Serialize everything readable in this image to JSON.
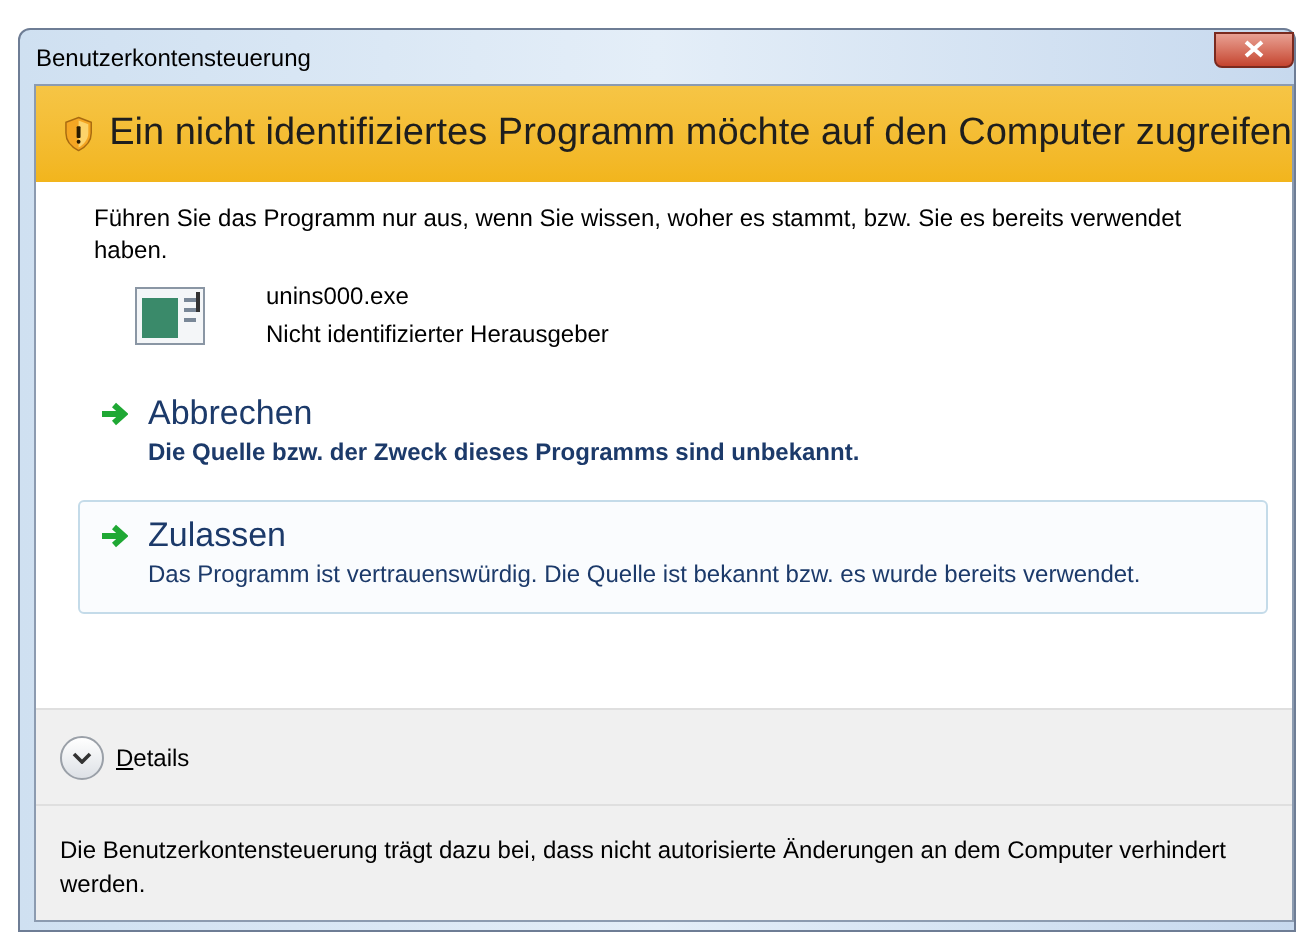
{
  "window": {
    "title": "Benutzerkontensteuerung"
  },
  "banner": {
    "text": "Ein nicht identifiziertes Programm möchte auf den Computer zugreifen"
  },
  "intro": "Führen Sie das Programm nur aus, wenn Sie wissen, woher es stammt, bzw. Sie es bereits verwendet haben.",
  "program": {
    "name": "unins000.exe",
    "publisher": "Nicht identifizierter Herausgeber"
  },
  "options": [
    {
      "title": "Abbrechen",
      "description": "Die Quelle bzw. der Zweck dieses Programms sind unbekannt.",
      "selected": false
    },
    {
      "title": "Zulassen",
      "description": "Das Programm ist vertrauenswürdig. Die Quelle ist bekannt bzw. es wurde bereits verwendet.",
      "selected": true
    }
  ],
  "details": {
    "label": "Details",
    "expanded": false
  },
  "footer": "Die Benutzerkontensteuerung trägt dazu bei, dass nicht autorisierte Änderungen an dem Computer verhindert werden."
}
